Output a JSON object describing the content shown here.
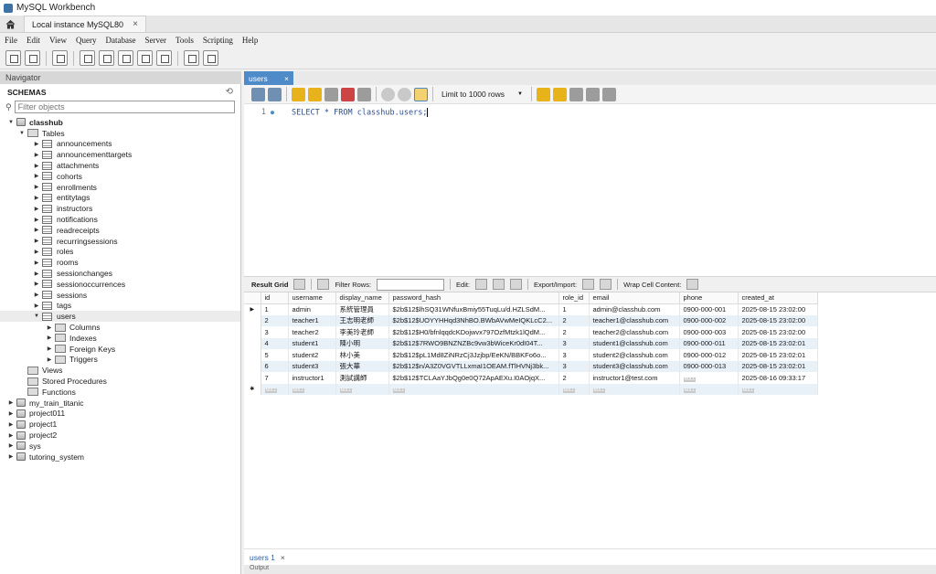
{
  "app": {
    "title": "MySQL Workbench"
  },
  "connection_tab": {
    "label": "Local instance MySQL80"
  },
  "menu": [
    "File",
    "Edit",
    "View",
    "Query",
    "Database",
    "Server",
    "Tools",
    "Scripting",
    "Help"
  ],
  "navigator": {
    "header": "Navigator",
    "schemas_label": "SCHEMAS",
    "filter_placeholder": "Filter objects",
    "schema_name": "classhub",
    "tables_label": "Tables",
    "tables": [
      "announcements",
      "announcementtargets",
      "attachments",
      "cohorts",
      "enrollments",
      "entitytags",
      "instructors",
      "notifications",
      "readreceipts",
      "recurringsessions",
      "roles",
      "rooms",
      "sessionchanges",
      "sessionoccurrences",
      "sessions",
      "tags",
      "users"
    ],
    "users_children": [
      "Columns",
      "Indexes",
      "Foreign Keys",
      "Triggers"
    ],
    "schema_nodes": [
      "Views",
      "Stored Procedures",
      "Functions"
    ],
    "other_schemas": [
      "my_train_titanic",
      "project011",
      "project1",
      "project2",
      "sys",
      "tutoring_system"
    ]
  },
  "query_tab": {
    "label": "users"
  },
  "query_toolbar": {
    "limit_label": "Limit to 1000 rows"
  },
  "editor": {
    "line_number": "1",
    "sql_keyword1": "SELECT",
    "sql_star": "*",
    "sql_keyword2": "FROM",
    "sql_target": "classhub.users;"
  },
  "result_toolbar": {
    "result_grid": "Result Grid",
    "filter_rows": "Filter Rows:",
    "edit": "Edit:",
    "export_import": "Export/Import:",
    "wrap": "Wrap Cell Content:"
  },
  "grid": {
    "columns": [
      "id",
      "username",
      "display_name",
      "password_hash",
      "role_id",
      "email",
      "phone",
      "created_at"
    ],
    "rows": [
      [
        "1",
        "admin",
        "系統管理員",
        "$2b$12$lhSQ31WNfuxBmiy55TuqLu/d.HZLSdM...",
        "1",
        "admin@classhub.com",
        "0900-000-001",
        "2025-08-15 23:02:00"
      ],
      [
        "2",
        "teacher1",
        "王志明老師",
        "$2b$12$UOYYHHqd3NhBO.BWbAVwMeIQKLcC2...",
        "2",
        "teacher1@classhub.com",
        "0900-000-002",
        "2025-08-15 23:02:00"
      ],
      [
        "3",
        "teacher2",
        "李美玲老師",
        "$2b$12$H0/bfnlqqdcKDojwvx797OzfMtzk1lQdM...",
        "2",
        "teacher2@classhub.com",
        "0900-000-003",
        "2025-08-15 23:02:00"
      ],
      [
        "4",
        "student1",
        "陳小明",
        "$2b$12$7RWO9BNZNZBc9vw3bWiceKr0dI04T...",
        "3",
        "student1@classhub.com",
        "0900-000-011",
        "2025-08-15 23:02:01"
      ],
      [
        "5",
        "student2",
        "林小美",
        "$2b$12$pL1Md8ZiNRzCj3Jzjbp/EeKN/BBKFo6o...",
        "3",
        "student2@classhub.com",
        "0900-000-012",
        "2025-08-15 23:02:01"
      ],
      [
        "6",
        "student3",
        "張大華",
        "$2b$12$n/A3Z0VGVTLLxmaI1OEAM.fTlHVNj3bk...",
        "3",
        "student3@classhub.com",
        "0900-000-013",
        "2025-08-15 23:02:01"
      ],
      [
        "7",
        "instructor1",
        "測試講師",
        "$2b$12$TCLAaYJbQg0e0Q72ApAEXu.I0AOjqX...",
        "2",
        "instructor1@test.com",
        "",
        "2025-08-16 09:33:17"
      ]
    ],
    "null_label": "NULL"
  },
  "bottom_tab": {
    "label": "users 1"
  },
  "output_label": "Output"
}
